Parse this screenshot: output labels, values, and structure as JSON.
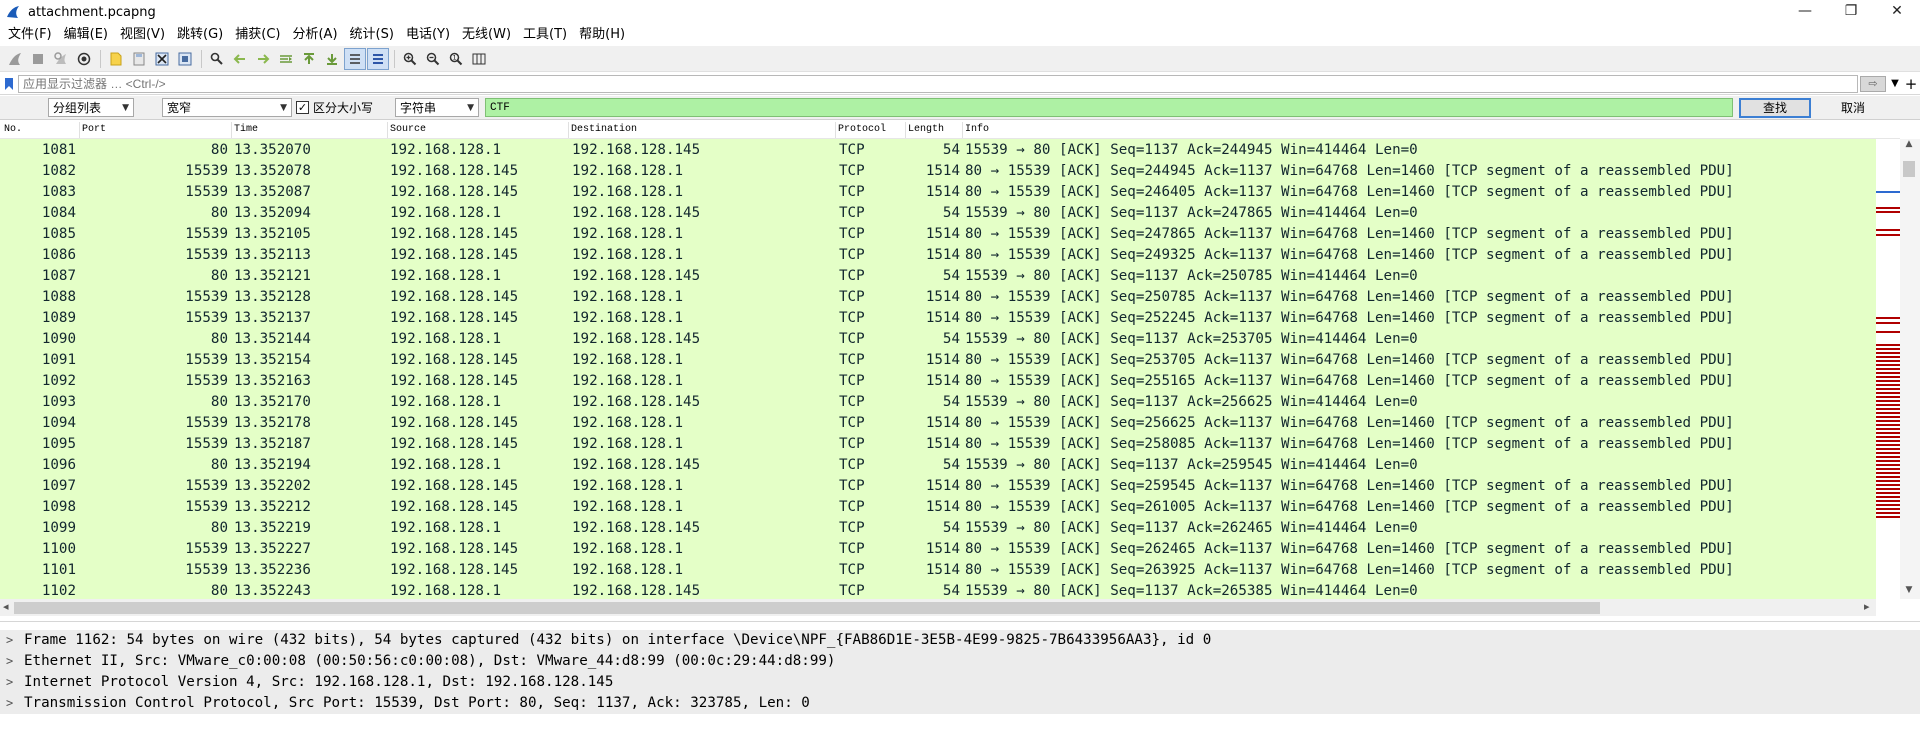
{
  "window": {
    "title": "attachment.pcapng",
    "minimize": "—",
    "maximize": "❐",
    "close": "✕"
  },
  "menu": [
    "文件(F)",
    "编辑(E)",
    "视图(V)",
    "跳转(G)",
    "捕获(C)",
    "分析(A)",
    "统计(S)",
    "电话(Y)",
    "无线(W)",
    "工具(T)",
    "帮助(H)"
  ],
  "toolbar": {
    "icons": [
      "shark-fin-start-icon",
      "stop-icon",
      "restart-icon",
      "capture-options-icon",
      "open-file-icon",
      "save-file-icon",
      "close-file-icon",
      "reload-icon",
      "find-packet-icon",
      "go-back-icon",
      "go-forward-icon",
      "go-to-packet-icon",
      "go-first-icon",
      "go-last-icon",
      "autoscroll-icon",
      "colorize-icon",
      "zoom-in-icon",
      "zoom-out-icon",
      "zoom-normal-icon",
      "resize-columns-icon"
    ]
  },
  "display_filter": {
    "placeholder": "应用显示过滤器 … <Ctrl-/>",
    "value": "",
    "apply_icon": "⇨",
    "plus": "+"
  },
  "find": {
    "search_in": "分组列表",
    "char_width": "宽窄",
    "case_sensitive_label": "区分大小写",
    "case_sensitive_checked": "✓",
    "search_type": "字符串",
    "query": "CTF",
    "find_label": "查找",
    "cancel_label": "取消"
  },
  "packet_list": {
    "columns": [
      "No.",
      "Port",
      "Time",
      "Source",
      "Destination",
      "Protocol",
      "Length",
      "Info"
    ],
    "rows": [
      {
        "no": "1081",
        "port": "80",
        "time": "13.352070",
        "src": "192.168.128.1",
        "dst": "192.168.128.145",
        "proto": "TCP",
        "len": "54",
        "info": "15539 → 80 [ACK] Seq=1137 Ack=244945 Win=414464 Len=0"
      },
      {
        "no": "1082",
        "port": "15539",
        "time": "13.352078",
        "src": "192.168.128.145",
        "dst": "192.168.128.1",
        "proto": "TCP",
        "len": "1514",
        "info": "80 → 15539 [ACK] Seq=244945 Ack=1137 Win=64768 Len=1460 [TCP segment of a reassembled PDU]"
      },
      {
        "no": "1083",
        "port": "15539",
        "time": "13.352087",
        "src": "192.168.128.145",
        "dst": "192.168.128.1",
        "proto": "TCP",
        "len": "1514",
        "info": "80 → 15539 [ACK] Seq=246405 Ack=1137 Win=64768 Len=1460 [TCP segment of a reassembled PDU]"
      },
      {
        "no": "1084",
        "port": "80",
        "time": "13.352094",
        "src": "192.168.128.1",
        "dst": "192.168.128.145",
        "proto": "TCP",
        "len": "54",
        "info": "15539 → 80 [ACK] Seq=1137 Ack=247865 Win=414464 Len=0"
      },
      {
        "no": "1085",
        "port": "15539",
        "time": "13.352105",
        "src": "192.168.128.145",
        "dst": "192.168.128.1",
        "proto": "TCP",
        "len": "1514",
        "info": "80 → 15539 [ACK] Seq=247865 Ack=1137 Win=64768 Len=1460 [TCP segment of a reassembled PDU]"
      },
      {
        "no": "1086",
        "port": "15539",
        "time": "13.352113",
        "src": "192.168.128.145",
        "dst": "192.168.128.1",
        "proto": "TCP",
        "len": "1514",
        "info": "80 → 15539 [ACK] Seq=249325 Ack=1137 Win=64768 Len=1460 [TCP segment of a reassembled PDU]"
      },
      {
        "no": "1087",
        "port": "80",
        "time": "13.352121",
        "src": "192.168.128.1",
        "dst": "192.168.128.145",
        "proto": "TCP",
        "len": "54",
        "info": "15539 → 80 [ACK] Seq=1137 Ack=250785 Win=414464 Len=0"
      },
      {
        "no": "1088",
        "port": "15539",
        "time": "13.352128",
        "src": "192.168.128.145",
        "dst": "192.168.128.1",
        "proto": "TCP",
        "len": "1514",
        "info": "80 → 15539 [ACK] Seq=250785 Ack=1137 Win=64768 Len=1460 [TCP segment of a reassembled PDU]"
      },
      {
        "no": "1089",
        "port": "15539",
        "time": "13.352137",
        "src": "192.168.128.145",
        "dst": "192.168.128.1",
        "proto": "TCP",
        "len": "1514",
        "info": "80 → 15539 [ACK] Seq=252245 Ack=1137 Win=64768 Len=1460 [TCP segment of a reassembled PDU]"
      },
      {
        "no": "1090",
        "port": "80",
        "time": "13.352144",
        "src": "192.168.128.1",
        "dst": "192.168.128.145",
        "proto": "TCP",
        "len": "54",
        "info": "15539 → 80 [ACK] Seq=1137 Ack=253705 Win=414464 Len=0"
      },
      {
        "no": "1091",
        "port": "15539",
        "time": "13.352154",
        "src": "192.168.128.145",
        "dst": "192.168.128.1",
        "proto": "TCP",
        "len": "1514",
        "info": "80 → 15539 [ACK] Seq=253705 Ack=1137 Win=64768 Len=1460 [TCP segment of a reassembled PDU]"
      },
      {
        "no": "1092",
        "port": "15539",
        "time": "13.352163",
        "src": "192.168.128.145",
        "dst": "192.168.128.1",
        "proto": "TCP",
        "len": "1514",
        "info": "80 → 15539 [ACK] Seq=255165 Ack=1137 Win=64768 Len=1460 [TCP segment of a reassembled PDU]"
      },
      {
        "no": "1093",
        "port": "80",
        "time": "13.352170",
        "src": "192.168.128.1",
        "dst": "192.168.128.145",
        "proto": "TCP",
        "len": "54",
        "info": "15539 → 80 [ACK] Seq=1137 Ack=256625 Win=414464 Len=0"
      },
      {
        "no": "1094",
        "port": "15539",
        "time": "13.352178",
        "src": "192.168.128.145",
        "dst": "192.168.128.1",
        "proto": "TCP",
        "len": "1514",
        "info": "80 → 15539 [ACK] Seq=256625 Ack=1137 Win=64768 Len=1460 [TCP segment of a reassembled PDU]"
      },
      {
        "no": "1095",
        "port": "15539",
        "time": "13.352187",
        "src": "192.168.128.145",
        "dst": "192.168.128.1",
        "proto": "TCP",
        "len": "1514",
        "info": "80 → 15539 [ACK] Seq=258085 Ack=1137 Win=64768 Len=1460 [TCP segment of a reassembled PDU]"
      },
      {
        "no": "1096",
        "port": "80",
        "time": "13.352194",
        "src": "192.168.128.1",
        "dst": "192.168.128.145",
        "proto": "TCP",
        "len": "54",
        "info": "15539 → 80 [ACK] Seq=1137 Ack=259545 Win=414464 Len=0"
      },
      {
        "no": "1097",
        "port": "15539",
        "time": "13.352202",
        "src": "192.168.128.145",
        "dst": "192.168.128.1",
        "proto": "TCP",
        "len": "1514",
        "info": "80 → 15539 [ACK] Seq=259545 Ack=1137 Win=64768 Len=1460 [TCP segment of a reassembled PDU]"
      },
      {
        "no": "1098",
        "port": "15539",
        "time": "13.352212",
        "src": "192.168.128.145",
        "dst": "192.168.128.1",
        "proto": "TCP",
        "len": "1514",
        "info": "80 → 15539 [ACK] Seq=261005 Ack=1137 Win=64768 Len=1460 [TCP segment of a reassembled PDU]"
      },
      {
        "no": "1099",
        "port": "80",
        "time": "13.352219",
        "src": "192.168.128.1",
        "dst": "192.168.128.145",
        "proto": "TCP",
        "len": "54",
        "info": "15539 → 80 [ACK] Seq=1137 Ack=262465 Win=414464 Len=0"
      },
      {
        "no": "1100",
        "port": "15539",
        "time": "13.352227",
        "src": "192.168.128.145",
        "dst": "192.168.128.1",
        "proto": "TCP",
        "len": "1514",
        "info": "80 → 15539 [ACK] Seq=262465 Ack=1137 Win=64768 Len=1460 [TCP segment of a reassembled PDU]"
      },
      {
        "no": "1101",
        "port": "15539",
        "time": "13.352236",
        "src": "192.168.128.145",
        "dst": "192.168.128.1",
        "proto": "TCP",
        "len": "1514",
        "info": "80 → 15539 [ACK] Seq=263925 Ack=1137 Win=64768 Len=1460 [TCP segment of a reassembled PDU]"
      },
      {
        "no": "1102",
        "port": "80",
        "time": "13.352243",
        "src": "192.168.128.1",
        "dst": "192.168.128.145",
        "proto": "TCP",
        "len": "54",
        "info": "15539 → 80 [ACK] Seq=1137 Ack=265385 Win=414464 Len=0"
      }
    ],
    "row_bg": "#e4ffc7",
    "row_fg": "#12272e",
    "minimap_mark_color": "#b00000"
  },
  "details": {
    "chevron": ">",
    "lines": [
      "Frame 1162: 54 bytes on wire (432 bits), 54 bytes captured (432 bits) on interface \\Device\\NPF_{FAB86D1E-3E5B-4E99-9825-7B6433956AA3}, id 0",
      "Ethernet II, Src: VMware_c0:00:08 (00:50:56:c0:00:08), Dst: VMware_44:d8:99 (00:0c:29:44:d8:99)",
      "Internet Protocol Version 4, Src: 192.168.128.1, Dst: 192.168.128.145",
      "Transmission Control Protocol, Src Port: 15539, Dst Port: 80, Seq: 1137, Ack: 323785, Len: 0"
    ]
  }
}
